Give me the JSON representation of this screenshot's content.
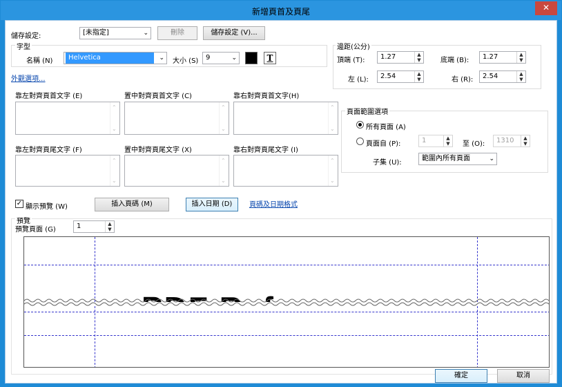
{
  "window": {
    "title": "新增頁首及頁尾",
    "close_glyph": "✕"
  },
  "saved_settings": {
    "label": "儲存設定:",
    "value": "[未指定]",
    "delete_label": "刪除",
    "save_label": "儲存設定 (V)..."
  },
  "font": {
    "group_label": "字型",
    "name_label": "名稱 (N)",
    "name_value": "Helvetica",
    "size_label": "大小 (S)",
    "size_value": "9",
    "color": "#000000",
    "underline_glyph": "T"
  },
  "appearance_link": "外觀選項...",
  "header_labels": {
    "left": "靠左對齊頁首文字 (E)",
    "center": "置中對齊頁首文字 (C)",
    "right": "靠右對齊頁首文字(H)"
  },
  "footer_labels": {
    "left": "靠左對齊頁尾文字 (F)",
    "center": "置中對齊頁尾文字 (X)",
    "right": "靠右對齊頁尾文字 (I)"
  },
  "margins": {
    "group_label": "邊距(公分)",
    "top_label": "頂端 (T):",
    "top_value": "1.27",
    "bottom_label": "底端 (B):",
    "bottom_value": "1.27",
    "left_label": "左 (L):",
    "left_value": "2.54",
    "right_label": "右 (R):",
    "right_value": "2.54"
  },
  "page_range": {
    "group_label": "頁面範圍選項",
    "all_pages_label": "所有頁面 (A)",
    "pages_from_label": "頁面自 (P):",
    "from_value": "1",
    "to_label": "至 (O):",
    "to_value": "1310",
    "subset_label": "子集 (U):",
    "subset_value": "範圍內所有頁面"
  },
  "show_preview": {
    "label": "顯示預覽 (W)",
    "checked_glyph": "✓"
  },
  "insert_page_number_label": "插入頁碼 (M)",
  "insert_date_label": "插入日期 (D)",
  "format_link": "頁碼及日期格式",
  "preview": {
    "group_label": "預覽",
    "page_label": "預覽頁面 (G)",
    "page_value": "1",
    "sample_text": "PDF Ref"
  },
  "footer_buttons": {
    "ok": "確定",
    "cancel": "取消"
  }
}
